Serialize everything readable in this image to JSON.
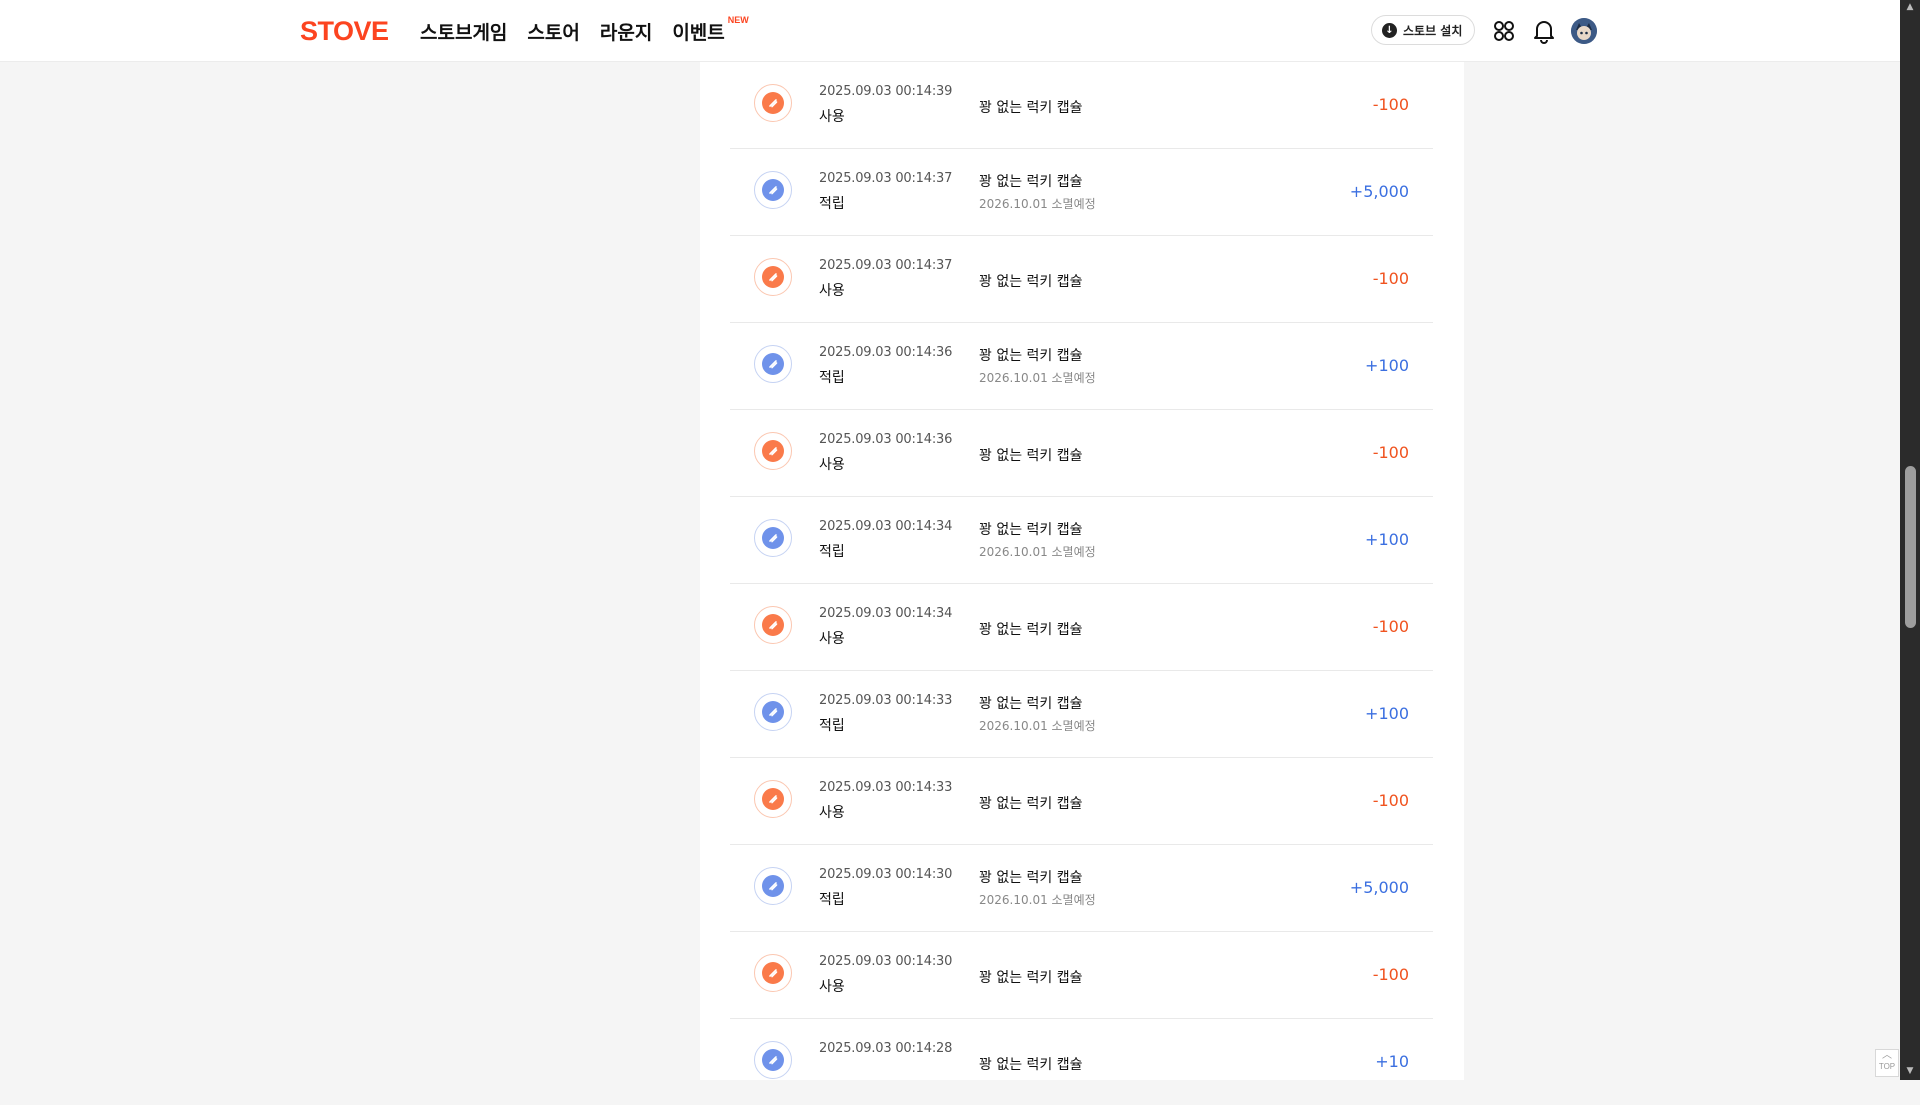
{
  "header": {
    "logo": "STOVE",
    "nav": [
      "스토브게임",
      "스토어",
      "라운지",
      "이벤트"
    ],
    "new_badge": "NEW",
    "install_label": "스토브 설치"
  },
  "transactions": [
    {
      "datetime": "2025.09.03 00:14:39",
      "type": "사용",
      "name": "꽝 없는 럭키 캡슐",
      "expire": "",
      "amount": "-100",
      "kind": "use"
    },
    {
      "datetime": "2025.09.03 00:14:37",
      "type": "적립",
      "name": "꽝 없는 럭키 캡슐",
      "expire": "2026.10.01 소멸예정",
      "amount": "+5,000",
      "kind": "earn"
    },
    {
      "datetime": "2025.09.03 00:14:37",
      "type": "사용",
      "name": "꽝 없는 럭키 캡슐",
      "expire": "",
      "amount": "-100",
      "kind": "use"
    },
    {
      "datetime": "2025.09.03 00:14:36",
      "type": "적립",
      "name": "꽝 없는 럭키 캡슐",
      "expire": "2026.10.01 소멸예정",
      "amount": "+100",
      "kind": "earn"
    },
    {
      "datetime": "2025.09.03 00:14:36",
      "type": "사용",
      "name": "꽝 없는 럭키 캡슐",
      "expire": "",
      "amount": "-100",
      "kind": "use"
    },
    {
      "datetime": "2025.09.03 00:14:34",
      "type": "적립",
      "name": "꽝 없는 럭키 캡슐",
      "expire": "2026.10.01 소멸예정",
      "amount": "+100",
      "kind": "earn"
    },
    {
      "datetime": "2025.09.03 00:14:34",
      "type": "사용",
      "name": "꽝 없는 럭키 캡슐",
      "expire": "",
      "amount": "-100",
      "kind": "use"
    },
    {
      "datetime": "2025.09.03 00:14:33",
      "type": "적립",
      "name": "꽝 없는 럭키 캡슐",
      "expire": "2026.10.01 소멸예정",
      "amount": "+100",
      "kind": "earn"
    },
    {
      "datetime": "2025.09.03 00:14:33",
      "type": "사용",
      "name": "꽝 없는 럭키 캡슐",
      "expire": "",
      "amount": "-100",
      "kind": "use"
    },
    {
      "datetime": "2025.09.03 00:14:30",
      "type": "적립",
      "name": "꽝 없는 럭키 캡슐",
      "expire": "2026.10.01 소멸예정",
      "amount": "+5,000",
      "kind": "earn"
    },
    {
      "datetime": "2025.09.03 00:14:30",
      "type": "사용",
      "name": "꽝 없는 럭키 캡슐",
      "expire": "",
      "amount": "-100",
      "kind": "use"
    },
    {
      "datetime": "2025.09.03 00:14:28",
      "type": "",
      "name": "꽝 없는 럭키 캡슐",
      "expire": "",
      "amount": "+10",
      "kind": "earn"
    }
  ],
  "top_button": "TOP",
  "icons": {
    "download": "download-icon",
    "apps": "apps-grid-icon",
    "bell": "bell-icon",
    "coin": "coin-icon"
  }
}
